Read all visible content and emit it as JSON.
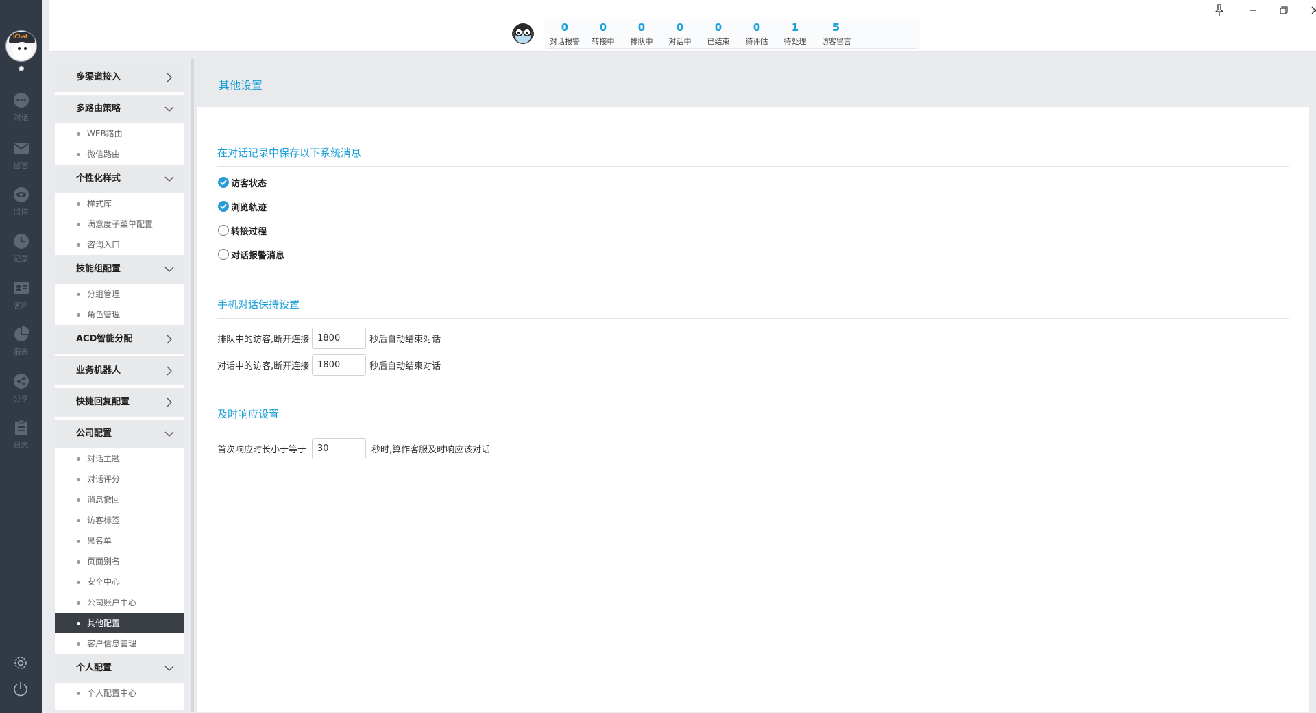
{
  "rail": {
    "items": [
      {
        "icon": "chat-bubble-icon",
        "label": "对话"
      },
      {
        "icon": "mail-icon",
        "label": "留言"
      },
      {
        "icon": "eye-icon",
        "label": "监控"
      },
      {
        "icon": "clock-icon",
        "label": "记录"
      },
      {
        "icon": "contact-card-icon",
        "label": "客户"
      },
      {
        "icon": "pie-chart-icon",
        "label": "报表"
      },
      {
        "icon": "share-icon",
        "label": "分享"
      },
      {
        "icon": "clipboard-icon",
        "label": "日志"
      }
    ],
    "avatar_text": "iChat"
  },
  "topbar": {
    "stats": [
      {
        "num": "0",
        "label": "对话报警"
      },
      {
        "num": "0",
        "label": "转接中"
      },
      {
        "num": "0",
        "label": "排队中"
      },
      {
        "num": "0",
        "label": "对话中"
      },
      {
        "num": "0",
        "label": "已结束"
      },
      {
        "num": "0",
        "label": "待评估"
      },
      {
        "num": "1",
        "label": "待处理"
      },
      {
        "num": "5",
        "label": "访客留言"
      }
    ]
  },
  "menu": {
    "groups": [
      {
        "label": "多渠道接入",
        "expanded": false,
        "items": []
      },
      {
        "label": "多路由策略",
        "expanded": true,
        "items": [
          "WEB路由",
          "微信路由"
        ]
      },
      {
        "label": "个性化样式",
        "expanded": true,
        "items": [
          "样式库",
          "满意度子菜单配置",
          "咨询入口"
        ]
      },
      {
        "label": "技能组配置",
        "expanded": true,
        "items": [
          "分组管理",
          "角色管理"
        ]
      },
      {
        "label": "ACD智能分配",
        "expanded": false,
        "items": []
      },
      {
        "label": "业务机器人",
        "expanded": false,
        "items": []
      },
      {
        "label": "快捷回复配置",
        "expanded": false,
        "items": []
      },
      {
        "label": "公司配置",
        "expanded": true,
        "items": [
          "对话主题",
          "对话评分",
          "消息撤回",
          "访客标签",
          "黑名单",
          "页面别名",
          "安全中心",
          "公司账户中心",
          "其他配置",
          "客户信息管理"
        ]
      },
      {
        "label": "个人配置",
        "expanded": true,
        "items": [
          "个人配置中心"
        ]
      }
    ],
    "active_item": "其他配置"
  },
  "main": {
    "title": "其他设置",
    "section1": {
      "title": "在对话记录中保存以下系统消息",
      "options": [
        {
          "label": "访客状态",
          "checked": true
        },
        {
          "label": "浏览轨迹",
          "checked": true
        },
        {
          "label": "转接过程",
          "checked": false
        },
        {
          "label": "对话报警消息",
          "checked": false
        }
      ]
    },
    "section2": {
      "title": "手机对话保持设置",
      "rows": [
        {
          "prefix": "排队中的访客,断开连接",
          "value": "1800",
          "suffix": "秒后自动结束对话"
        },
        {
          "prefix": "对话中的访客,断开连接",
          "value": "1800",
          "suffix": "秒后自动结束对话"
        }
      ]
    },
    "section3": {
      "title": "及时响应设置",
      "row": {
        "prefix": "首次响应时长小于等于",
        "value": "30",
        "suffix": "秒时,算作客服及时响应该对话"
      }
    }
  },
  "colors": {
    "rail_bg": "#323b45",
    "accent": "#1aa3d9",
    "active_menu_bg": "#3a3f45"
  }
}
